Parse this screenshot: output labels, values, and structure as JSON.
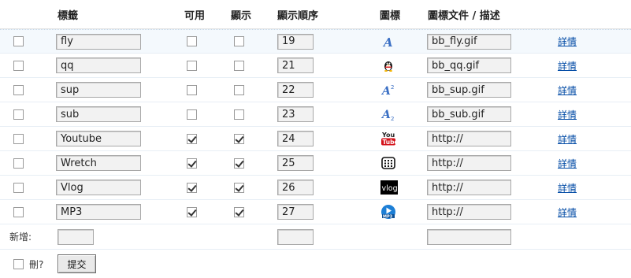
{
  "header": {
    "tag": "標籤",
    "enabled": "可用",
    "display": "顯示",
    "order": "顯示順序",
    "icon": "圖標",
    "icon_file": "圖標文件 / 描述"
  },
  "rows": [
    {
      "tag": "fly",
      "enabled": false,
      "display": false,
      "order": "19",
      "icon": "italic-a-icon",
      "file": "bb_fly.gif",
      "detail": "詳情"
    },
    {
      "tag": "qq",
      "enabled": false,
      "display": false,
      "order": "21",
      "icon": "penguin-icon",
      "file": "bb_qq.gif",
      "detail": "詳情"
    },
    {
      "tag": "sup",
      "enabled": false,
      "display": false,
      "order": "22",
      "icon": "superscript-icon",
      "file": "bb_sup.gif",
      "detail": "詳情"
    },
    {
      "tag": "sub",
      "enabled": false,
      "display": false,
      "order": "23",
      "icon": "subscript-icon",
      "file": "bb_sub.gif",
      "detail": "詳情"
    },
    {
      "tag": "Youtube",
      "enabled": true,
      "display": true,
      "order": "24",
      "icon": "youtube-icon",
      "file": "http://",
      "detail": "詳情"
    },
    {
      "tag": "Wretch",
      "enabled": true,
      "display": true,
      "order": "25",
      "icon": "wretch-icon",
      "file": "http://",
      "detail": "詳情"
    },
    {
      "tag": "Vlog",
      "enabled": true,
      "display": true,
      "order": "26",
      "icon": "vlog-icon",
      "file": "http://",
      "detail": "詳情"
    },
    {
      "tag": "MP3",
      "enabled": true,
      "display": true,
      "order": "27",
      "icon": "mp3-icon",
      "file": "http://",
      "detail": "詳情"
    }
  ],
  "add_row": {
    "label": "新增:",
    "tag": "",
    "order": "",
    "file": ""
  },
  "footer": {
    "delete_label": "刪?",
    "submit_label": "提交"
  },
  "colors": {
    "link": "#004aa5",
    "highlight_row": "#f4f9fd"
  }
}
